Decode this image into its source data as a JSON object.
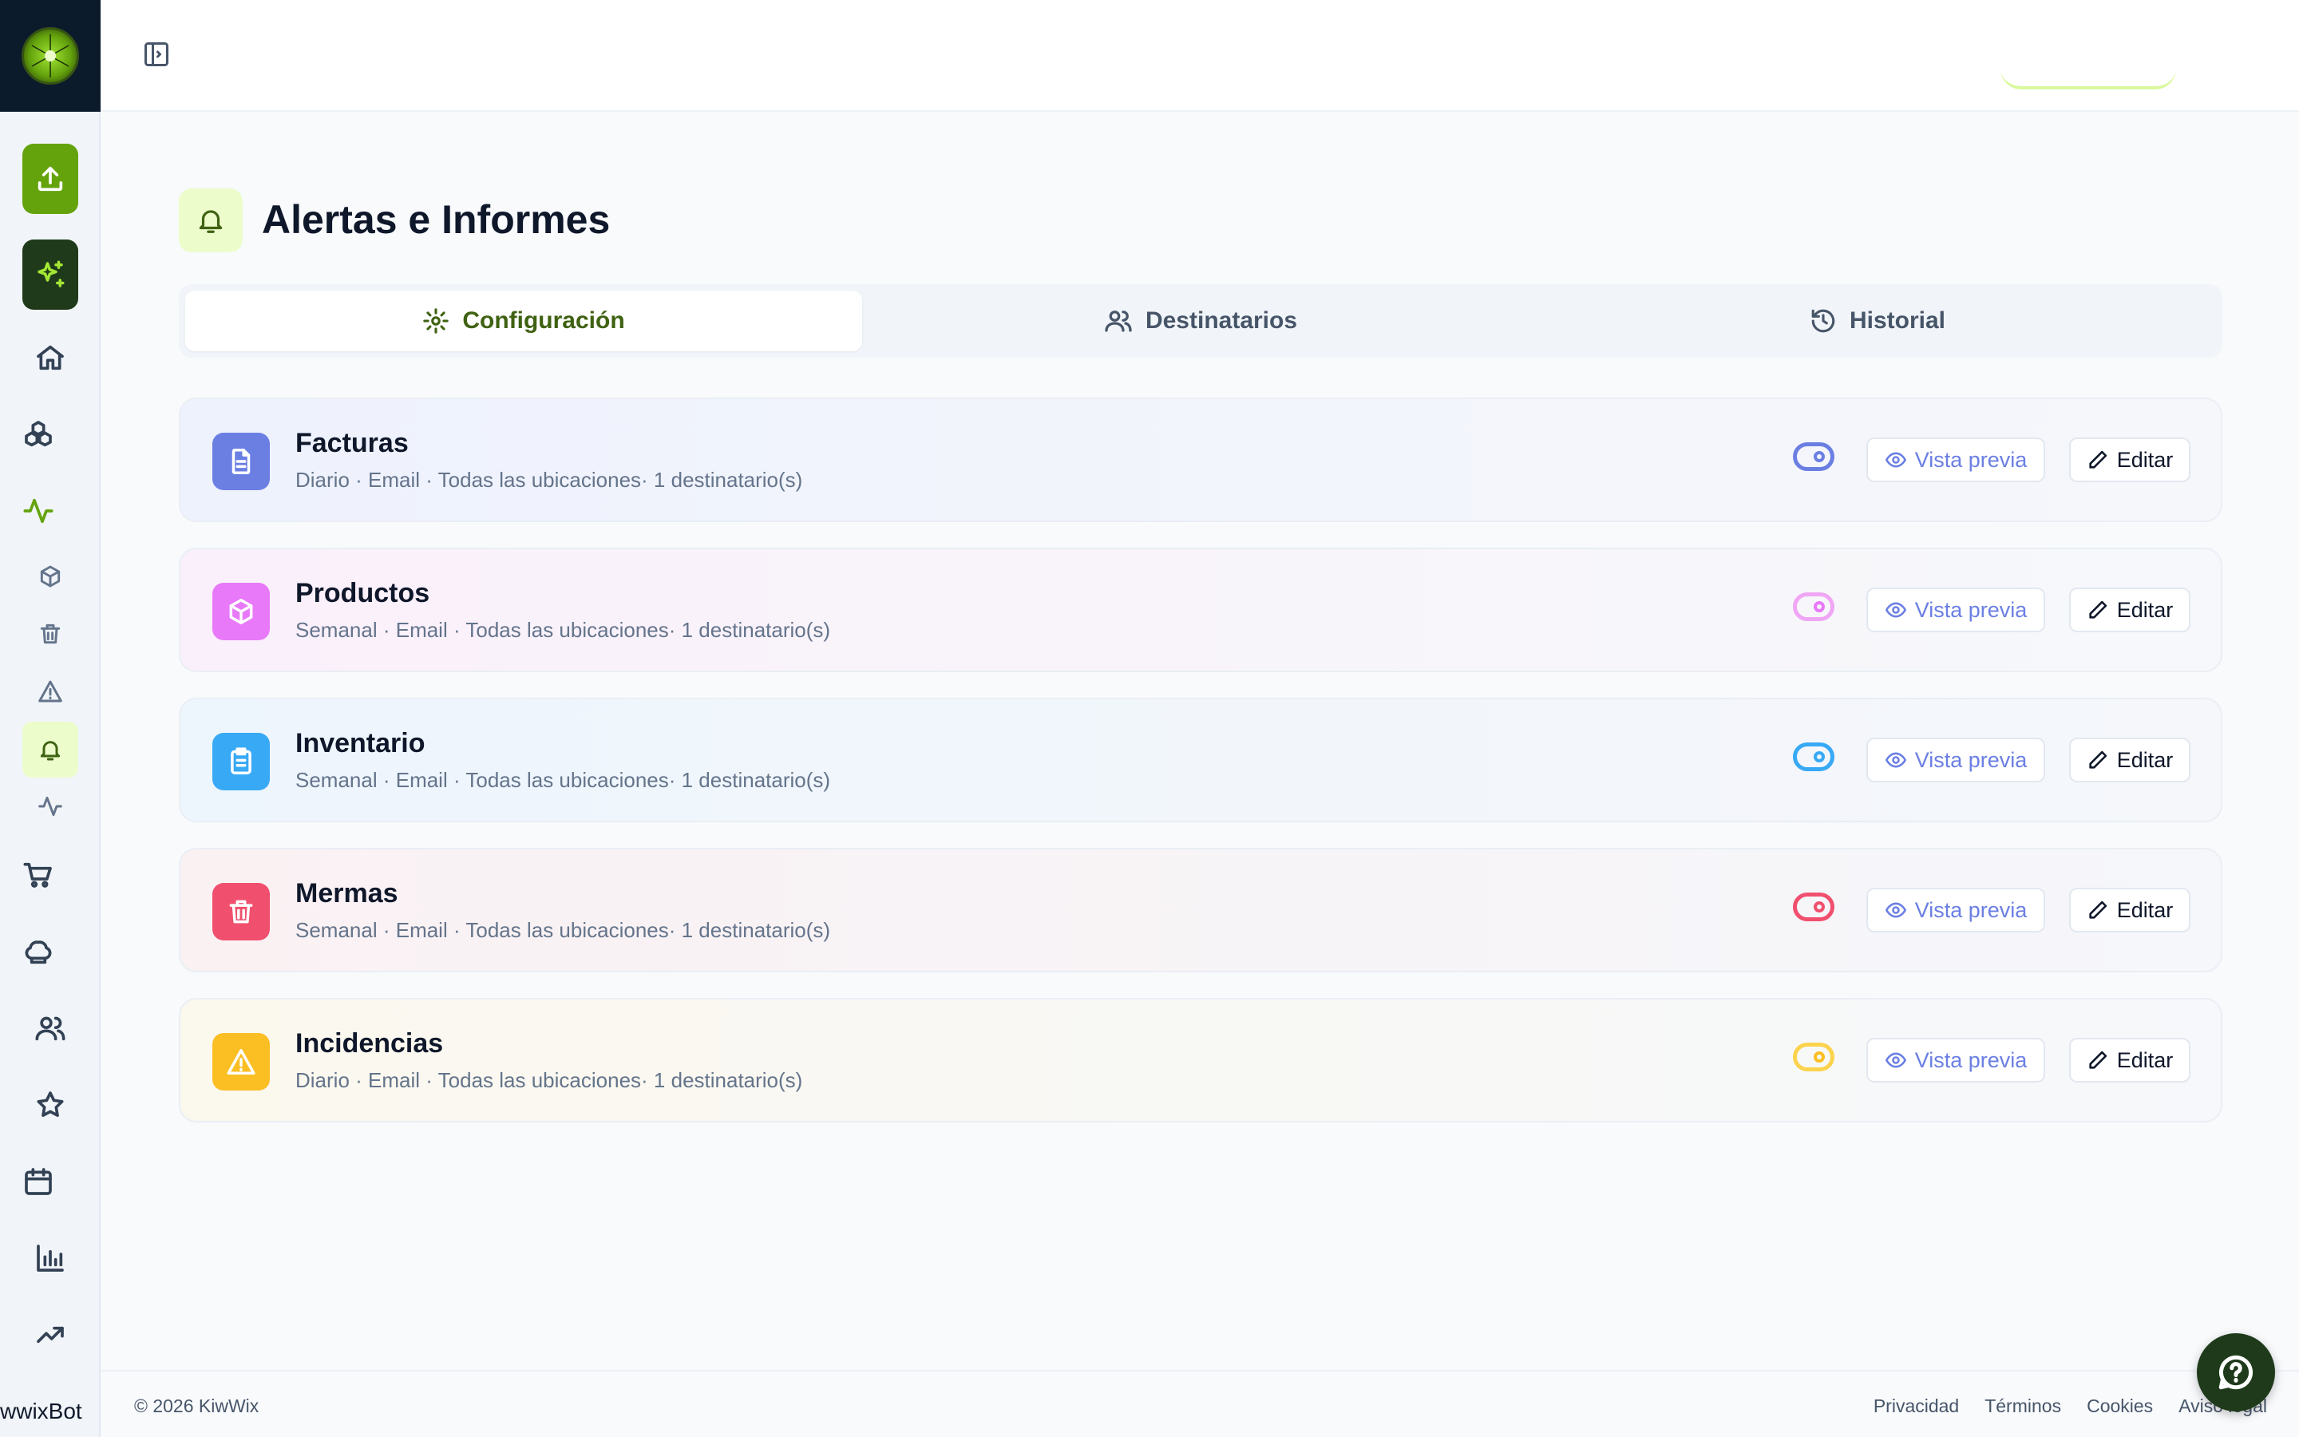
{
  "app": {
    "name": "KiwWix",
    "bot_label": "wwixBot"
  },
  "sidebar": {
    "items": [
      {
        "id": "upload",
        "icon": "upload-icon"
      },
      {
        "id": "ai",
        "icon": "sparkles-icon"
      },
      {
        "id": "home",
        "icon": "home-icon"
      },
      {
        "id": "boxes",
        "icon": "boxes-icon"
      },
      {
        "id": "activity",
        "icon": "activity-icon"
      },
      {
        "id": "package",
        "icon": "package-icon"
      },
      {
        "id": "trash",
        "icon": "trash-icon"
      },
      {
        "id": "warning",
        "icon": "warning-icon"
      },
      {
        "id": "alerts",
        "icon": "bell-icon",
        "selected": true
      },
      {
        "id": "pulse",
        "icon": "activity-icon"
      },
      {
        "id": "cart",
        "icon": "cart-icon"
      },
      {
        "id": "chef",
        "icon": "chef-hat-icon"
      },
      {
        "id": "users",
        "icon": "users-icon"
      },
      {
        "id": "star",
        "icon": "star-icon"
      },
      {
        "id": "calendar",
        "icon": "calendar-icon"
      },
      {
        "id": "chart",
        "icon": "bar-chart-icon"
      },
      {
        "id": "trend",
        "icon": "trending-up-icon"
      }
    ]
  },
  "page": {
    "title": "Alertas e Informes",
    "icon": "bell-icon"
  },
  "tabs": [
    {
      "label": "Configuración",
      "icon": "gear-icon",
      "active": true
    },
    {
      "label": "Destinatarios",
      "icon": "users-icon",
      "active": false
    },
    {
      "label": "Historial",
      "icon": "history-icon",
      "active": false
    }
  ],
  "reports": [
    {
      "title": "Facturas",
      "subtitle": "Diario · Email · Todas las ubicaciones· 1 destinatario(s)",
      "icon": "file-text-icon",
      "color": "#6b7fe3",
      "enabled": true
    },
    {
      "title": "Productos",
      "subtitle": "Semanal · Email · Todas las ubicaciones· 1 destinatario(s)",
      "icon": "package-icon",
      "color": "#e879f9",
      "enabled": true
    },
    {
      "title": "Inventario",
      "subtitle": "Semanal · Email · Todas las ubicaciones· 1 destinatario(s)",
      "icon": "clipboard-list-icon",
      "color": "#38a9f5",
      "enabled": true
    },
    {
      "title": "Mermas",
      "subtitle": "Semanal · Email · Todas las ubicaciones· 1 destinatario(s)",
      "icon": "trash-icon",
      "color": "#f0506e",
      "enabled": true
    },
    {
      "title": "Incidencias",
      "subtitle": "Diario · Email · Todas las ubicaciones· 1 destinatario(s)",
      "icon": "warning-icon",
      "color": "#fbbf24",
      "enabled": true
    }
  ],
  "actions": {
    "preview_label": "Vista previa",
    "edit_label": "Editar"
  },
  "footer": {
    "copyright": "© 2026 KiwWix",
    "links": [
      "Privacidad",
      "Términos",
      "Cookies",
      "Aviso legal"
    ]
  },
  "colors": {
    "brand": "#65a30d",
    "brand_dark": "#1e3a1a",
    "active_tab_text": "#3f6212"
  }
}
